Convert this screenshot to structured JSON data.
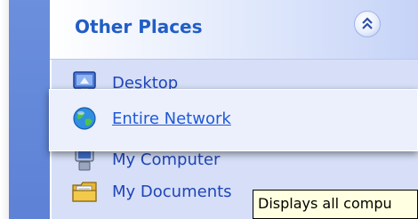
{
  "panel": {
    "title": "Other Places",
    "collapse_icon": "double-chevron-up-icon"
  },
  "items": [
    {
      "label": "Desktop",
      "icon": "desktop-icon"
    },
    {
      "label": "Entire Network",
      "icon": "globe-icon"
    },
    {
      "label": "My Computer",
      "icon": "computer-icon"
    },
    {
      "label": "My Documents",
      "icon": "folder-documents-icon"
    }
  ],
  "tooltip": {
    "text": "Displays all compu"
  },
  "colors": {
    "sidebar_blue": "#5d82d6",
    "panel_bg": "#d6dff7",
    "title_text": "#215dc6",
    "link_text": "#1f45b8",
    "tooltip_bg": "#ffffe1"
  }
}
